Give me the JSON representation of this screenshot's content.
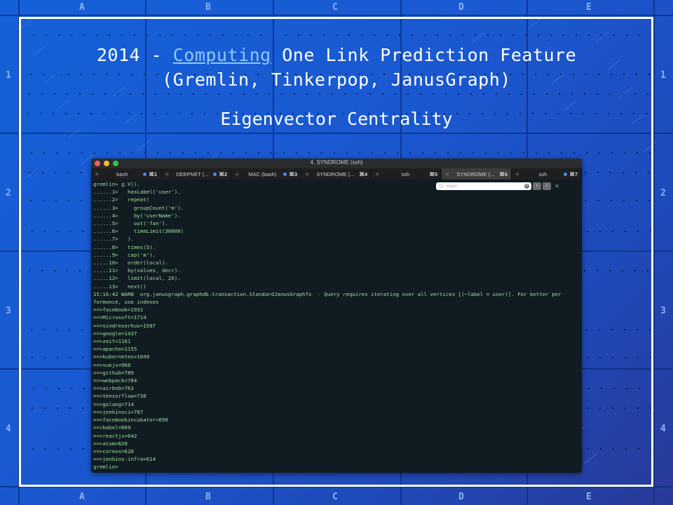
{
  "ruler": {
    "columns": [
      "A",
      "B",
      "C",
      "D",
      "E"
    ],
    "rows": [
      "1",
      "2",
      "3",
      "4"
    ]
  },
  "slide": {
    "title_year": "2014 - ",
    "title_link": "Computing",
    "title_rest": " One Link Prediction Feature",
    "title_line2": "(Gremlin, Tinkerpop, JanusGraph)",
    "subtitle": "Eigenvector Centrality"
  },
  "terminal": {
    "window_title": "4. SYNDROME (ssh)",
    "tabs": [
      {
        "close": "✕",
        "name": "bash",
        "shortcut": "⌘1",
        "dot": true,
        "active": false
      },
      {
        "close": "✕",
        "name": "DEEPNET (...",
        "shortcut": "⌘2",
        "dot": true,
        "active": false
      },
      {
        "close": "✕",
        "name": "MAC (bash)",
        "shortcut": "⌘3",
        "dot": true,
        "active": false
      },
      {
        "close": "✕",
        "name": "SYNDROME (...",
        "shortcut": "⌘4",
        "dot": false,
        "active": false
      },
      {
        "close": "✕",
        "name": "ssh",
        "shortcut": "⌘5",
        "dot": false,
        "active": false
      },
      {
        "close": "✕",
        "name": "SYNDROME (...",
        "shortcut": "⌘6",
        "dot": false,
        "active": true
      },
      {
        "close": "✕",
        "name": "ssh",
        "shortcut": "⌘7",
        "dot": true,
        "active": false
      }
    ],
    "find": {
      "placeholder": "Q~ eigen",
      "prev": "‹",
      "next": "›",
      "close": "✕"
    },
    "lines": [
      "gremlin> g.V().",
      "......1>   hasLabel('user').",
      "......2>   repeat(",
      "......3>     groupCount('m').",
      "......4>     by('userName').",
      "......5>     out('fan').",
      "......6>     timeLimit(30000)",
      "......7>   ).",
      "......8>   times(5).",
      "......9>   cap('m').",
      ".....10>   order(local).",
      ".....11>   by(values, decr).",
      ".....12>   limit(local, 20).",
      ".....13>   next()",
      "15:16:42 WARN  org.janusgraph.graphdb.transaction.StandardJanusGraphTx  - Query requires iterating over all vertices [(~label = user)]. For better per",
      "formance, use indexes",
      "==>facebook=1931",
      "==>Microsoft=1714",
      "==>sindresorhus=1507",
      "==>google=1437",
      "==>zeit=1161",
      "==>apache=1155",
      "==>kubernetes=1049",
      "==>vuejs=966",
      "==>github=789",
      "==>webpack=784",
      "==>airbnb=763",
      "==>tensorflow=730",
      "==>golang=714",
      "==>jenkinsci=707",
      "==>facebookincubator=690",
      "==>babel=669",
      "==>reactjs=642",
      "==>atom=620",
      "==>coreos=620",
      "==>jenkins-infra=614",
      "gremlin>"
    ]
  },
  "colors": {
    "background": "#1a58d0",
    "frame": "#ffffff",
    "title_link": "#8ec8ff",
    "terminal_bg": "#111b22",
    "terminal_text": "#9ee29b",
    "traffic_red": "#fc5f57",
    "traffic_yellow": "#fdbc2e",
    "traffic_green": "#33c748"
  }
}
